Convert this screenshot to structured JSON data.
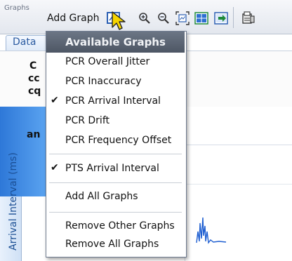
{
  "toolbar": {
    "group_label": "Graphs",
    "add_graph_label": "Add Graph"
  },
  "background": {
    "data_tab": "Data",
    "prop_rows": [
      "C",
      "cc",
      "cq"
    ],
    "header_text": "an",
    "dash_rows": [
      "-",
      "-",
      "-"
    ],
    "axis_title": "Arrival Interval (ms)"
  },
  "menu": {
    "header": "Available Graphs",
    "items": [
      {
        "label": "PCR Overall Jitter",
        "checked": false
      },
      {
        "label": "PCR Inaccuracy",
        "checked": false
      },
      {
        "label": "PCR Arrival Interval",
        "checked": true
      },
      {
        "label": "PCR Drift",
        "checked": false
      },
      {
        "label": "PCR Frequency Offset",
        "checked": false
      },
      {
        "label": "PTS Arrival Interval",
        "checked": true
      },
      {
        "label": "Add All Graphs",
        "checked": false
      },
      {
        "label": "Remove Other Graphs",
        "checked": false
      },
      {
        "label": "Remove All Graphs",
        "checked": false
      }
    ],
    "check_glyph": "✔"
  },
  "colors": {
    "menu_header": "#5a6372",
    "accent_blue": "#2e78d8",
    "plot_blue": "#1f5fd1"
  },
  "icons": [
    "add-graph-icon",
    "zoom-in-icon",
    "zoom-out-icon",
    "zoom-fit-icon",
    "grid-icon",
    "export-icon",
    "print-icon",
    "cursor-icon"
  ]
}
